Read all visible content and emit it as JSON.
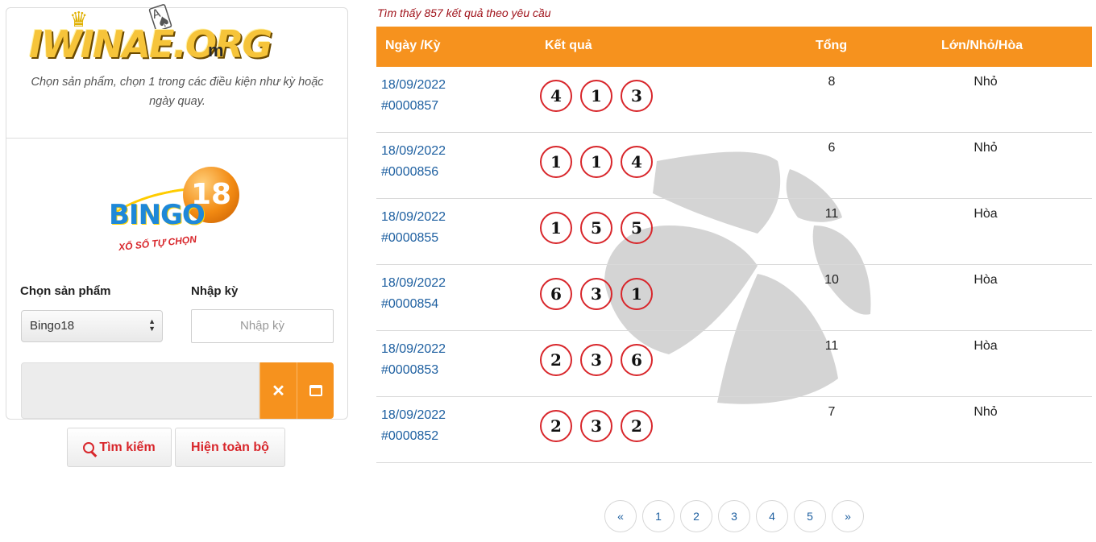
{
  "brand": {
    "logo_text": "IWINAE.ORG",
    "logo_suffix": "m"
  },
  "panel": {
    "description": "Chọn sản phẩm, chọn 1 trong các điều kiện như kỳ hoặc ngày quay.",
    "product_logo": {
      "word": "BINGO",
      "number": "18",
      "tagline": "XỔ SỐ TỰ CHỌN"
    },
    "product_label": "Chọn sản phẩm",
    "product_selected": "Bingo18",
    "period_label": "Nhập kỳ",
    "period_placeholder": "Nhập kỳ",
    "date_value": "",
    "clear_glyph": "✕",
    "search_label": "Tìm kiếm",
    "show_all_label": "Hiện toàn bộ"
  },
  "results": {
    "count_text": "Tìm thấy 857 kết quả theo yêu cầu",
    "headers": {
      "date": "Ngày /Kỳ",
      "result": "Kết quả",
      "total": "Tổng",
      "size": "Lớn/Nhỏ/Hòa"
    },
    "rows": [
      {
        "date": "18/09/2022",
        "period": "#0000857",
        "balls": [
          "4",
          "1",
          "3"
        ],
        "total": "8",
        "size": "Nhỏ"
      },
      {
        "date": "18/09/2022",
        "period": "#0000856",
        "balls": [
          "1",
          "1",
          "4"
        ],
        "total": "6",
        "size": "Nhỏ"
      },
      {
        "date": "18/09/2022",
        "period": "#0000855",
        "balls": [
          "1",
          "5",
          "5"
        ],
        "total": "11",
        "size": "Hòa"
      },
      {
        "date": "18/09/2022",
        "period": "#0000854",
        "balls": [
          "6",
          "3",
          "1"
        ],
        "total": "10",
        "size": "Hòa"
      },
      {
        "date": "18/09/2022",
        "period": "#0000853",
        "balls": [
          "2",
          "3",
          "6"
        ],
        "total": "11",
        "size": "Hòa"
      },
      {
        "date": "18/09/2022",
        "period": "#0000852",
        "balls": [
          "2",
          "3",
          "2"
        ],
        "total": "7",
        "size": "Nhỏ"
      }
    ]
  },
  "pagination": {
    "prev": "«",
    "pages": [
      "1",
      "2",
      "3",
      "4",
      "5"
    ],
    "next": "»"
  },
  "colors": {
    "accent": "#f6921e",
    "ball_border": "#d8262b",
    "link": "#1d5fa0",
    "count_text": "#a0131b"
  },
  "icons": {
    "search": "search-icon",
    "clear": "close-icon",
    "calendar": "calendar-icon",
    "select": "chevron-updown-icon"
  }
}
